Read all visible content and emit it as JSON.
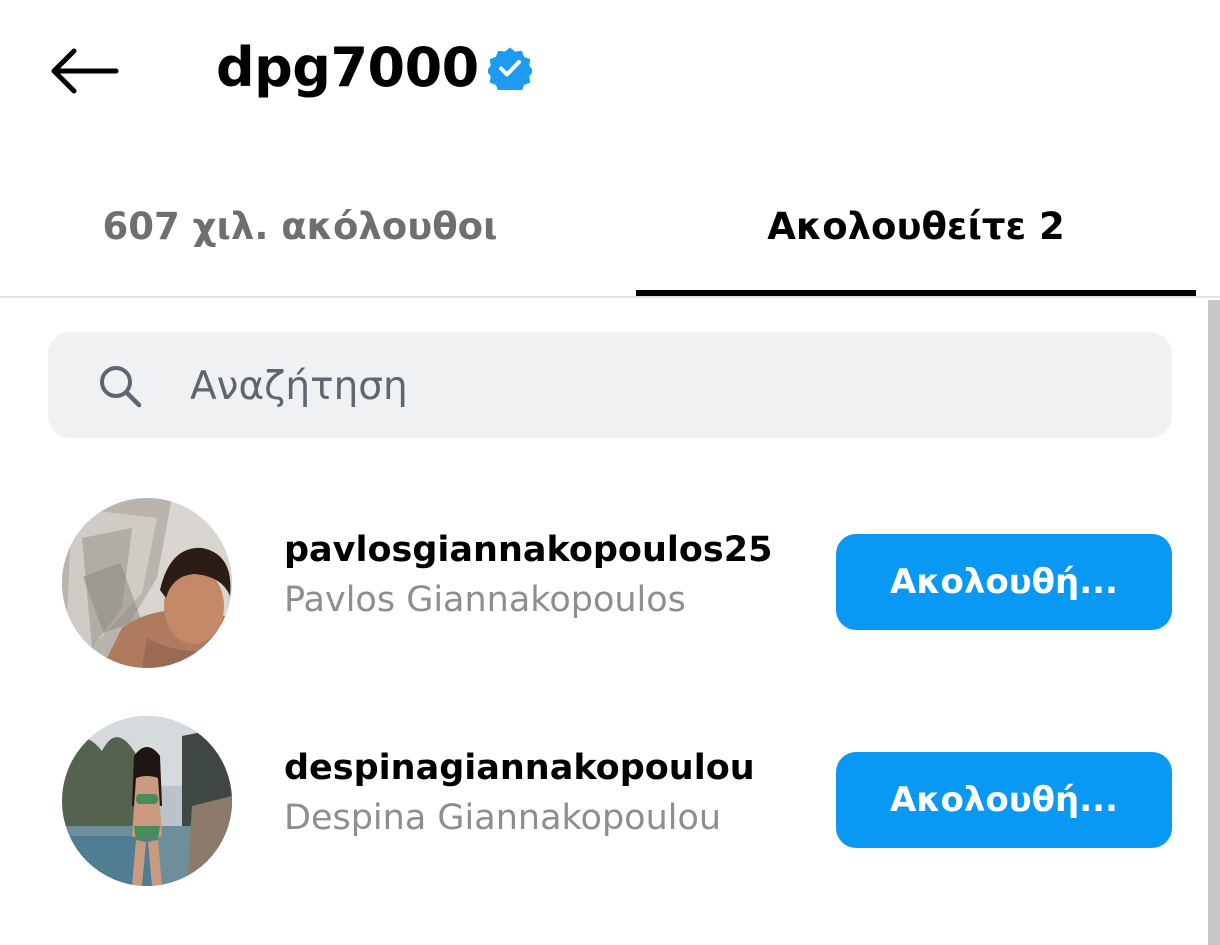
{
  "header": {
    "username": "dpg7000",
    "back_icon": "arrow-left-icon",
    "verified_icon": "verified-badge-icon",
    "verified_color": "#1d9bf0"
  },
  "tabs": [
    {
      "label": "607 χιλ. ακόλουθοι",
      "active": false
    },
    {
      "label": "Ακολουθείτε 2",
      "active": true
    }
  ],
  "search": {
    "placeholder": "Αναζήτηση",
    "value": "",
    "icon": "search-icon"
  },
  "list": [
    {
      "handle": "pavlosgiannakopoulos25",
      "name": "Pavlos Giannakopoulos",
      "button_label": "Ακολουθή...",
      "avatar": "avatar-photo"
    },
    {
      "handle": "despinagiannakopoulou",
      "name": "Despina Giannakopoulou",
      "button_label": "Ακολουθή...",
      "avatar": "avatar-photo"
    }
  ],
  "colors": {
    "accent": "#0a98f5",
    "secondary_text": "#8e8e8e",
    "search_bg": "#eff1f3"
  }
}
